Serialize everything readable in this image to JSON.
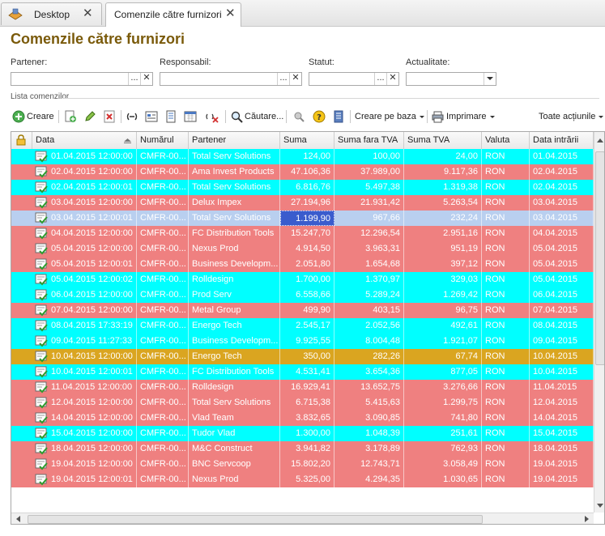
{
  "colors": {
    "row_cyan": "#00ffff",
    "row_red": "#ef8080",
    "row_orange": "#daa520",
    "row_selected": "#b9cfef",
    "title": "#7a5a0a"
  },
  "tabs": [
    {
      "label": "Desktop",
      "icon": "desktop-icon"
    },
    {
      "label": "Comenzile către furnizori",
      "icon": ""
    }
  ],
  "page_title": "Comenzile către furnizori",
  "filters": {
    "partener": {
      "label": "Partener:",
      "value": ""
    },
    "responsabil": {
      "label": "Responsabil:",
      "value": ""
    },
    "statut": {
      "label": "Statut:",
      "value": ""
    },
    "actualitate": {
      "label": "Actualitate:",
      "value": ""
    }
  },
  "section_label": "Lista comenzilor",
  "toolbar": {
    "create": "Creare",
    "search": "Căutare...",
    "create_based": "Creare pe baza",
    "print": "Imprimare",
    "all_actions": "Toate acțiunile"
  },
  "columns": [
    "Data",
    "Numărul",
    "Partener",
    "Suma",
    "Suma fara TVA",
    "Suma TVA",
    "Valuta",
    "Data intrării"
  ],
  "rows": [
    {
      "color": "cyan",
      "data": "01.04.2015 12:00:00",
      "numar": "CMFR-00...",
      "partener": "Total Serv Solutions",
      "suma": "124,00",
      "fara": "100,00",
      "tva": "24,00",
      "valuta": "RON",
      "intrare": "01.04.2015"
    },
    {
      "color": "red",
      "data": "02.04.2015 12:00:00",
      "numar": "CMFR-00...",
      "partener": "Ama Invest Products",
      "suma": "47.106,36",
      "fara": "37.989,00",
      "tva": "9.117,36",
      "valuta": "RON",
      "intrare": "02.04.2015"
    },
    {
      "color": "cyan",
      "data": "02.04.2015 12:00:01",
      "numar": "CMFR-00...",
      "partener": "Total Serv Solutions",
      "suma": "6.816,76",
      "fara": "5.497,38",
      "tva": "1.319,38",
      "valuta": "RON",
      "intrare": "02.04.2015"
    },
    {
      "color": "red",
      "data": "03.04.2015 12:00:00",
      "numar": "CMFR-00...",
      "partener": "Delux Impex",
      "suma": "27.194,96",
      "fara": "21.931,42",
      "tva": "5.263,54",
      "valuta": "RON",
      "intrare": "03.04.2015"
    },
    {
      "color": "sel",
      "data": "03.04.2015 12:00:01",
      "numar": "CMFR-00...",
      "partener": "Total Serv Solutions",
      "suma": "1.199,90",
      "fara": "967,66",
      "tva": "232,24",
      "valuta": "RON",
      "intrare": "03.04.2015"
    },
    {
      "color": "red",
      "data": "04.04.2015 12:00:00",
      "numar": "CMFR-00...",
      "partener": "FC Distribution Tools",
      "suma": "15.247,70",
      "fara": "12.296,54",
      "tva": "2.951,16",
      "valuta": "RON",
      "intrare": "04.04.2015"
    },
    {
      "color": "red",
      "data": "05.04.2015 12:00:00",
      "numar": "CMFR-00...",
      "partener": "Nexus Prod",
      "suma": "4.914,50",
      "fara": "3.963,31",
      "tva": "951,19",
      "valuta": "RON",
      "intrare": "05.04.2015"
    },
    {
      "color": "red",
      "data": "05.04.2015 12:00:01",
      "numar": "CMFR-00...",
      "partener": "Business Developm...",
      "suma": "2.051,80",
      "fara": "1.654,68",
      "tva": "397,12",
      "valuta": "RON",
      "intrare": "05.04.2015"
    },
    {
      "color": "cyan",
      "data": "05.04.2015 12:00:02",
      "numar": "CMFR-00...",
      "partener": "Rolldesign",
      "suma": "1.700,00",
      "fara": "1.370,97",
      "tva": "329,03",
      "valuta": "RON",
      "intrare": "05.04.2015"
    },
    {
      "color": "cyan",
      "data": "06.04.2015 12:00:00",
      "numar": "CMFR-00...",
      "partener": "Prod Serv",
      "suma": "6.558,66",
      "fara": "5.289,24",
      "tva": "1.269,42",
      "valuta": "RON",
      "intrare": "06.04.2015"
    },
    {
      "color": "red",
      "data": "07.04.2015 12:00:00",
      "numar": "CMFR-00...",
      "partener": "Metal Group",
      "suma": "499,90",
      "fara": "403,15",
      "tva": "96,75",
      "valuta": "RON",
      "intrare": "07.04.2015"
    },
    {
      "color": "cyan",
      "data": "08.04.2015 17:33:19",
      "numar": "CMFR-00...",
      "partener": "Energo Tech",
      "suma": "2.545,17",
      "fara": "2.052,56",
      "tva": "492,61",
      "valuta": "RON",
      "intrare": "08.04.2015"
    },
    {
      "color": "cyan",
      "data": "09.04.2015 11:27:33",
      "numar": "CMFR-00...",
      "partener": "Business Developm...",
      "suma": "9.925,55",
      "fara": "8.004,48",
      "tva": "1.921,07",
      "valuta": "RON",
      "intrare": "09.04.2015"
    },
    {
      "color": "orange",
      "data": "10.04.2015 12:00:00",
      "numar": "CMFR-00...",
      "partener": "Energo Tech",
      "suma": "350,00",
      "fara": "282,26",
      "tva": "67,74",
      "valuta": "RON",
      "intrare": "10.04.2015"
    },
    {
      "color": "cyan",
      "data": "10.04.2015 12:00:01",
      "numar": "CMFR-00...",
      "partener": "FC Distribution Tools",
      "suma": "4.531,41",
      "fara": "3.654,36",
      "tva": "877,05",
      "valuta": "RON",
      "intrare": "10.04.2015"
    },
    {
      "color": "red",
      "data": "11.04.2015 12:00:00",
      "numar": "CMFR-00...",
      "partener": "Rolldesign",
      "suma": "16.929,41",
      "fara": "13.652,75",
      "tva": "3.276,66",
      "valuta": "RON",
      "intrare": "11.04.2015"
    },
    {
      "color": "red",
      "data": "12.04.2015 12:00:00",
      "numar": "CMFR-00...",
      "partener": "Total Serv Solutions",
      "suma": "6.715,38",
      "fara": "5.415,63",
      "tva": "1.299,75",
      "valuta": "RON",
      "intrare": "12.04.2015"
    },
    {
      "color": "red",
      "data": "14.04.2015 12:00:00",
      "numar": "CMFR-00...",
      "partener": "Vlad Team",
      "suma": "3.832,65",
      "fara": "3.090,85",
      "tva": "741,80",
      "valuta": "RON",
      "intrare": "14.04.2015"
    },
    {
      "color": "cyan",
      "data": "15.04.2015 12:00:00",
      "numar": "CMFR-00...",
      "partener": "Tudor Vlad",
      "suma": "1.300,00",
      "fara": "1.048,39",
      "tva": "251,61",
      "valuta": "RON",
      "intrare": "15.04.2015"
    },
    {
      "color": "red",
      "data": "18.04.2015 12:00:00",
      "numar": "CMFR-00...",
      "partener": "M&C Construct",
      "suma": "3.941,82",
      "fara": "3.178,89",
      "tva": "762,93",
      "valuta": "RON",
      "intrare": "18.04.2015"
    },
    {
      "color": "red",
      "data": "19.04.2015 12:00:00",
      "numar": "CMFR-00...",
      "partener": "BNC Servcoop",
      "suma": "15.802,20",
      "fara": "12.743,71",
      "tva": "3.058,49",
      "valuta": "RON",
      "intrare": "19.04.2015"
    },
    {
      "color": "red",
      "data": "19.04.2015 12:00:01",
      "numar": "CMFR-00...",
      "partener": "Nexus Prod",
      "suma": "5.325,00",
      "fara": "4.294,35",
      "tva": "1.030,65",
      "valuta": "RON",
      "intrare": "19.04.2015"
    }
  ]
}
